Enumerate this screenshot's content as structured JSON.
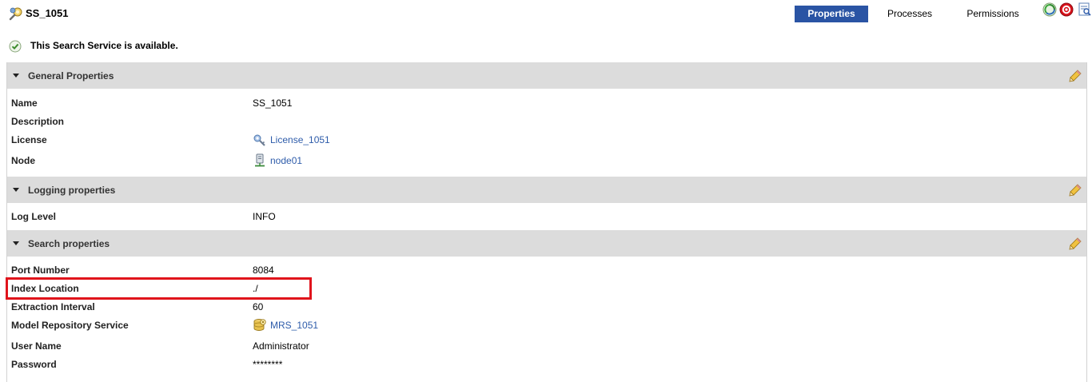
{
  "service": {
    "name": "SS_1051",
    "icon": "search-service-icon"
  },
  "tabs": [
    {
      "label": "Properties",
      "active": true
    },
    {
      "label": "Processes",
      "active": false
    },
    {
      "label": "Permissions",
      "active": false
    }
  ],
  "actions": [
    "recycle-icon",
    "disable-icon",
    "view-log-icon"
  ],
  "status": {
    "text": "This Search Service is available.",
    "icon": "check-circle-icon"
  },
  "sections": {
    "general": {
      "title": "General Properties",
      "rows": [
        {
          "label": "Name",
          "value": "SS_1051"
        },
        {
          "label": "Description",
          "value": ""
        },
        {
          "label": "License",
          "value": "License_1051",
          "icon": "license-icon"
        },
        {
          "label": "Node",
          "value": "node01",
          "icon": "node-icon"
        }
      ]
    },
    "logging": {
      "title": "Logging properties",
      "rows": [
        {
          "label": "Log Level",
          "value": "INFO"
        }
      ]
    },
    "search": {
      "title": "Search properties",
      "rows": [
        {
          "label": "Port Number",
          "value": "8084"
        },
        {
          "label": "Index Location",
          "value": "./"
        },
        {
          "label": "Extraction Interval",
          "value": "60"
        },
        {
          "label": "Model Repository Service",
          "value": "MRS_1051",
          "icon": "repository-service-icon"
        },
        {
          "label": "User Name",
          "value": "Administrator"
        },
        {
          "label": "Password",
          "value": "********"
        }
      ]
    }
  },
  "colors": {
    "accent": "#2a54a4",
    "link": "#2e5caa",
    "highlight": "#e0141c",
    "section_bg": "#dcdcdc"
  }
}
